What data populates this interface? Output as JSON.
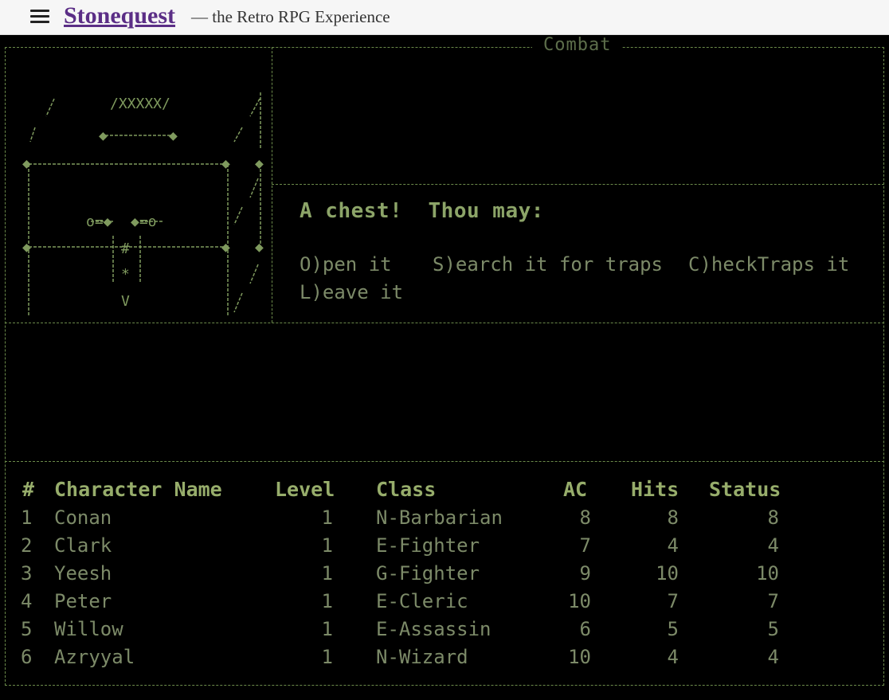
{
  "header": {
    "site_title": "Stonequest",
    "tagline": "— the Retro RPG Experience"
  },
  "game": {
    "mode": "Combat",
    "prompt": "A chest!  Thou may:",
    "options": [
      "O)pen it",
      "S)earch it for traps",
      "C)heckTraps it",
      "L)eave it"
    ],
    "party": {
      "columns": [
        "#",
        "Character Name",
        "Level",
        "Class",
        "AC",
        "Hits",
        "Status"
      ],
      "rows": [
        [
          "1",
          "Conan",
          "1",
          "N-Barbarian",
          "8",
          "8",
          "8"
        ],
        [
          "2",
          "Clark",
          "1",
          "E-Fighter",
          "7",
          "4",
          "4"
        ],
        [
          "3",
          "Yeesh",
          "1",
          "G-Fighter",
          "9",
          "10",
          "10"
        ],
        [
          "4",
          "Peter",
          "1",
          "E-Cleric",
          "10",
          "7",
          "7"
        ],
        [
          "5",
          "Willow",
          "1",
          "E-Assassin",
          "6",
          "5",
          "5"
        ],
        [
          "6",
          "Azryyal",
          "1",
          "N-Wizard",
          "10",
          "4",
          "4"
        ]
      ]
    }
  }
}
